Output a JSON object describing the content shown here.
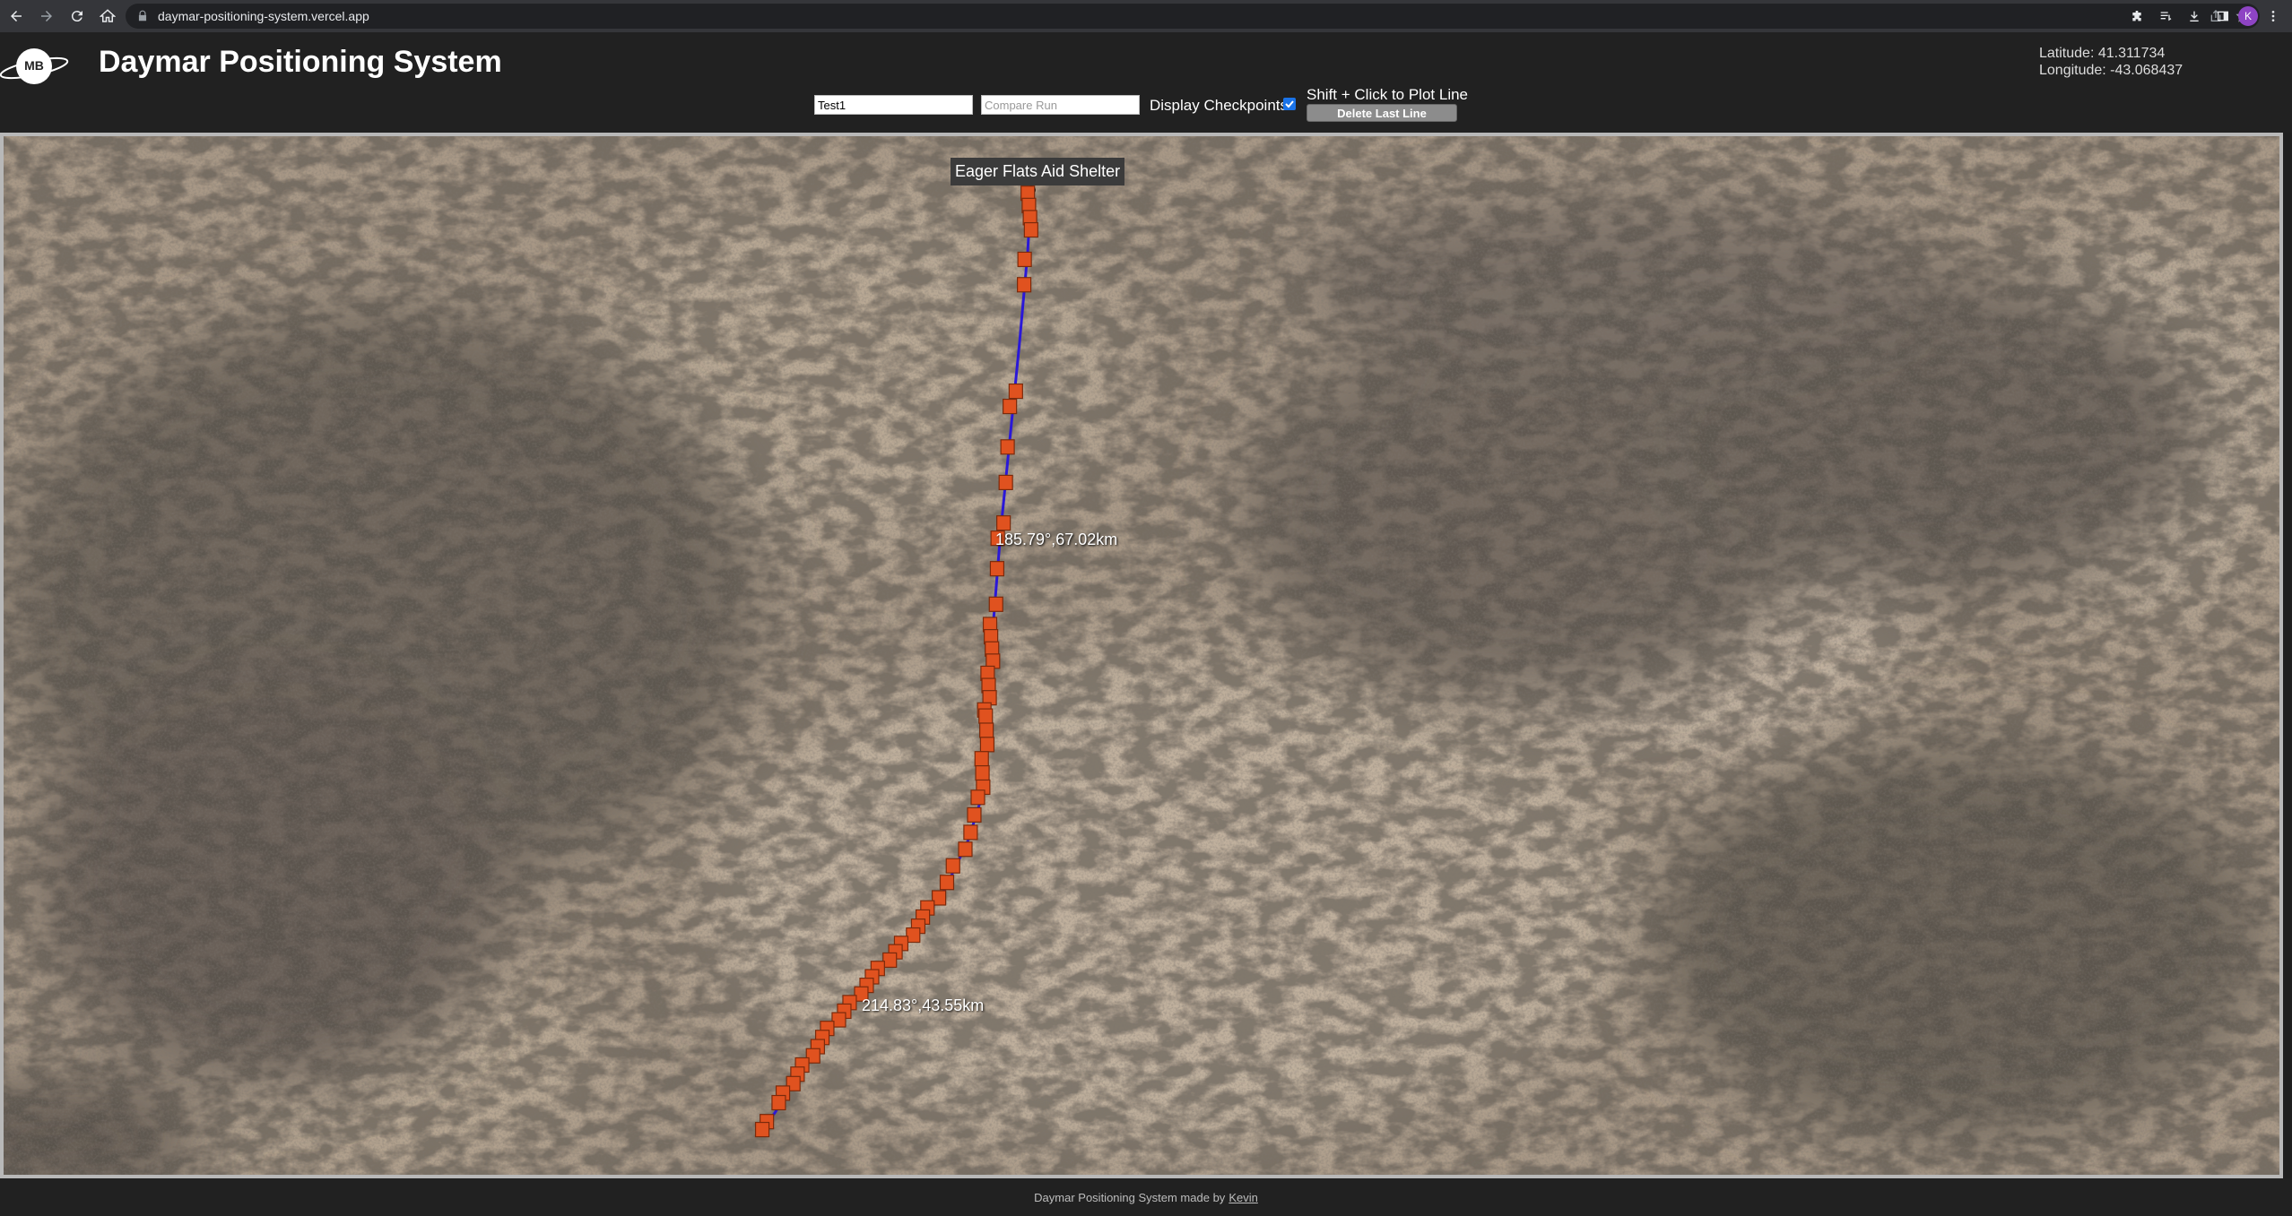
{
  "browser": {
    "url": "daymar-positioning-system.vercel.app",
    "profile_initial": "K",
    "icons": [
      "back-icon",
      "forward-icon",
      "reload-icon",
      "home-icon",
      "lock-icon",
      "share-icon",
      "star-icon",
      "extensions-icon",
      "reading-list-icon",
      "download-icon",
      "sidebar-icon",
      "menu-icon"
    ]
  },
  "header": {
    "title": "Daymar Positioning System",
    "latitude_text": "Latitude: 41.311734",
    "longitude_text": "Longitude: -43.068437"
  },
  "controls": {
    "run_value": "Test1",
    "compare_placeholder": "Compare Run",
    "display_checkpoints_label": "Display Checkpoints",
    "display_checkpoints_checked": true,
    "shift_hint": "Shift + Click to Plot Line",
    "delete_label": "Delete Last Line"
  },
  "map": {
    "poi_label": "Eager Flats Aid Shelter",
    "segments": [
      {
        "label": "185.79°,67.02km"
      },
      {
        "label": "214.83°,43.55km"
      }
    ],
    "colors": {
      "line": "#2a18d8",
      "checkpoint": "#e0521f",
      "terrain": "#a89886"
    }
  },
  "footer": {
    "text": "Daymar Positioning System made by",
    "link": "Kevin"
  }
}
